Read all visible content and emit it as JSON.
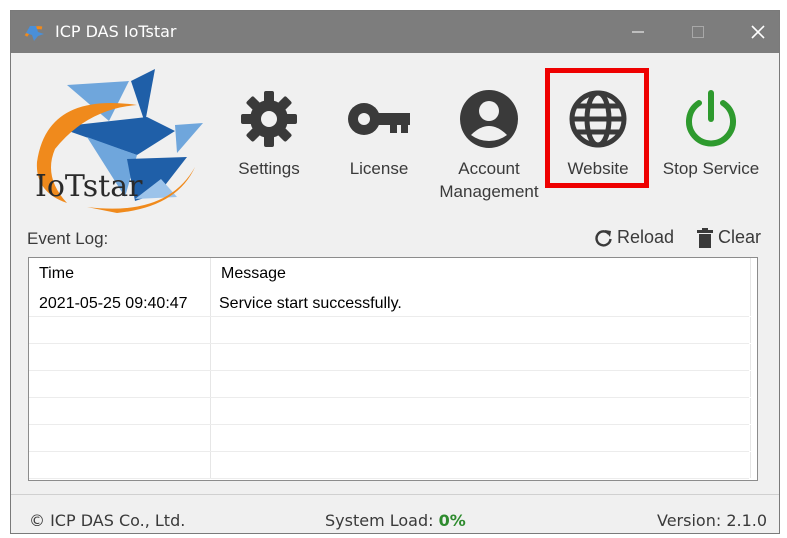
{
  "window": {
    "title": "ICP DAS IoTstar"
  },
  "logo": {
    "text": "IoTstar"
  },
  "toolbar": {
    "settings_label": "Settings",
    "license_label": "License",
    "account_label_1": "Account",
    "account_label_2": "Management",
    "website_label": "Website",
    "stop_label": "Stop Service"
  },
  "eventlog": {
    "label": "Event Log:",
    "reload_label": "Reload",
    "clear_label": "Clear",
    "columns": [
      "Time",
      "Message"
    ],
    "rows": [
      {
        "time": "2021-05-25 09:40:47",
        "message": "Service start successfully."
      }
    ]
  },
  "status": {
    "copyright": "© ICP DAS Co., Ltd.",
    "load_label": "System Load:",
    "load_value": "0%",
    "version": "Version: 2.1.0"
  },
  "colors": {
    "titlebar": "#7d7d7d",
    "icon": "#3a3a3a",
    "stop_icon": "#2e9a2e",
    "highlight": "#ee0000",
    "logo_blue": "#1f5fa8",
    "logo_orange": "#f08a1c"
  }
}
